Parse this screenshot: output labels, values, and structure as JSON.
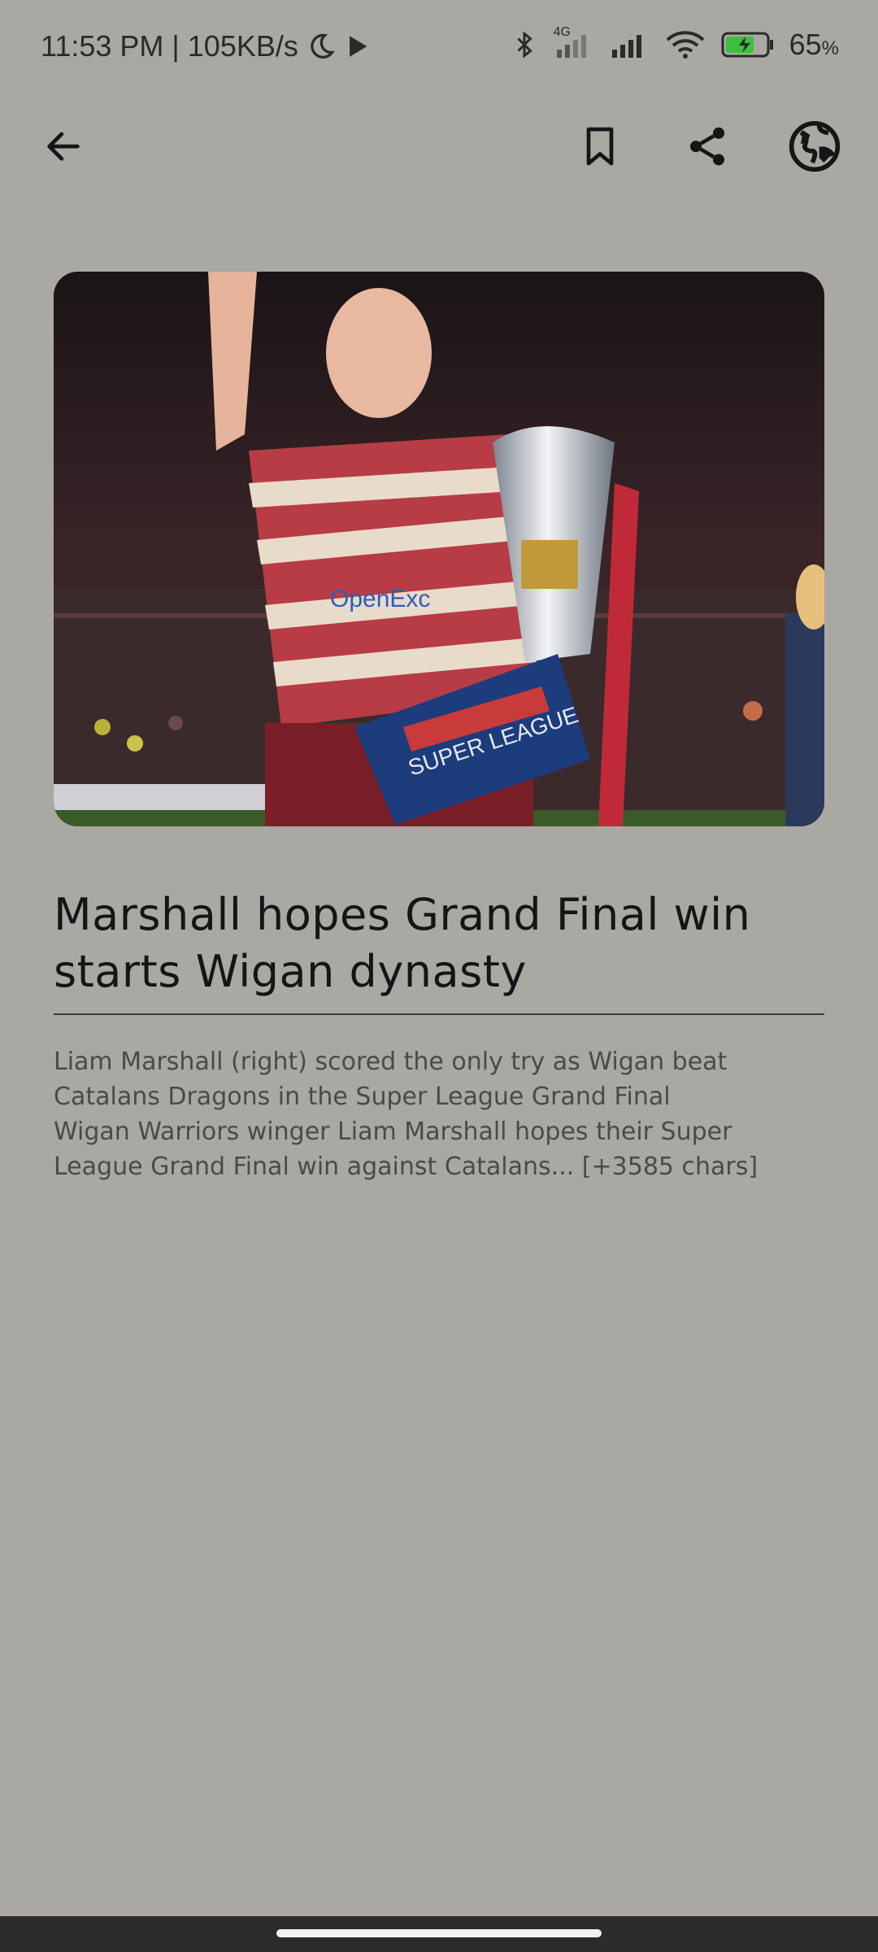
{
  "status": {
    "time_speed": "11:53 PM | 105KB/s",
    "network_label": "4G",
    "battery": "65",
    "battery_unit": "%"
  },
  "toolbar": {
    "back_icon": "arrow-left-icon",
    "bookmark_icon": "bookmark-icon",
    "share_icon": "share-icon",
    "browser_icon": "globe-icon"
  },
  "article": {
    "title": "Marshall hopes Grand Final win starts Wigan dynasty",
    "summary": "Liam Marshall (right) scored the only try as Wigan beat\nCatalans Dragons in the Super League Grand Final\nWigan Warriors winger Liam Marshall hopes their Super\nLeague Grand Final win against Catalans... [+3585 chars]"
  },
  "colors": {
    "background": "#a9a8a3",
    "text": "#151515",
    "nav_bar": "#2b2b2b"
  }
}
